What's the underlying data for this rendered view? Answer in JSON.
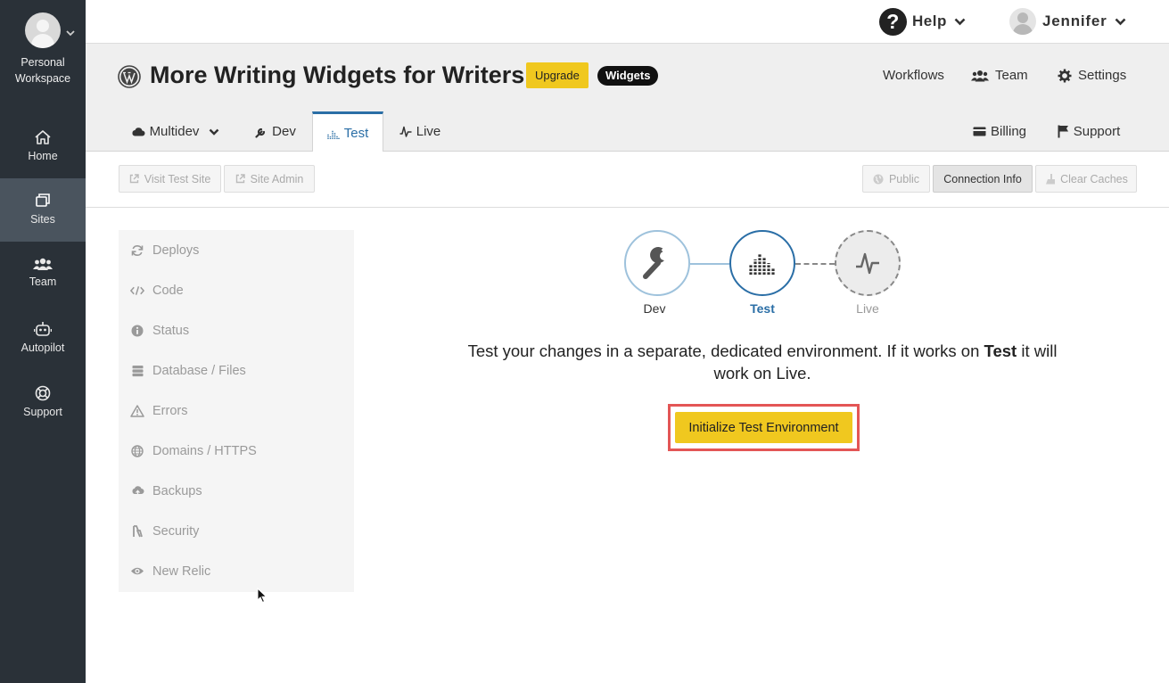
{
  "leftnav": {
    "workspace_label": "Personal Workspace",
    "items": [
      {
        "label": "Home",
        "icon": "home-icon"
      },
      {
        "label": "Sites",
        "icon": "sites-icon",
        "active": true
      },
      {
        "label": "Team",
        "icon": "team-icon"
      },
      {
        "label": "Autopilot",
        "icon": "robot-icon"
      },
      {
        "label": "Support",
        "icon": "lifebuoy-icon"
      }
    ]
  },
  "topbar": {
    "help_label": "Help",
    "user_name": "Jennifer"
  },
  "site": {
    "title": "More Writing Widgets for Writers",
    "upgrade_badge": "Upgrade",
    "plan_badge": "Widgets",
    "links": {
      "workflows": "Workflows",
      "team": "Team",
      "settings": "Settings",
      "billing": "Billing",
      "support": "Support"
    },
    "tabs": [
      {
        "label": "Multidev",
        "icon": "cloud-icon"
      },
      {
        "label": "Dev",
        "icon": "wrench-icon"
      },
      {
        "label": "Test",
        "icon": "equalizer-icon",
        "active": true
      },
      {
        "label": "Live",
        "icon": "pulse-icon"
      }
    ]
  },
  "toolbar": {
    "visit_site": "Visit Test Site",
    "site_admin": "Site Admin",
    "public": "Public",
    "connection_info": "Connection Info",
    "clear_caches": "Clear Caches"
  },
  "sidemenu": {
    "items": [
      {
        "label": "Deploys",
        "icon": "refresh-icon"
      },
      {
        "label": "Code",
        "icon": "code-icon"
      },
      {
        "label": "Status",
        "icon": "info-icon"
      },
      {
        "label": "Database / Files",
        "icon": "database-icon"
      },
      {
        "label": "Errors",
        "icon": "warning-icon"
      },
      {
        "label": "Domains / HTTPS",
        "icon": "globe-icon"
      },
      {
        "label": "Backups",
        "icon": "cloud-upload-icon"
      },
      {
        "label": "Security",
        "icon": "security-icon"
      },
      {
        "label": "New Relic",
        "icon": "eye-icon"
      }
    ]
  },
  "pipeline": {
    "dev": "Dev",
    "test": "Test",
    "live": "Live"
  },
  "main": {
    "desc_pre": "Test your changes in a separate, dedicated environment. If it works on ",
    "desc_bold": "Test",
    "desc_post": " it will work on Live.",
    "cta_label": "Initialize Test Environment"
  },
  "colors": {
    "nav_bg": "#2a3138",
    "nav_active": "#4a545e",
    "accent": "#2a6ea6",
    "cta": "#f0c81f",
    "highlight": "#e35656"
  }
}
